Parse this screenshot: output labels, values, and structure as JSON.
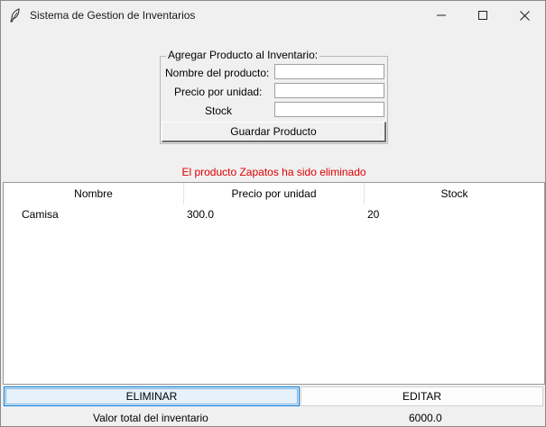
{
  "window": {
    "title": "Sistema de Gestion de Inventarios"
  },
  "form": {
    "legend": "Agregar Producto al Inventario:",
    "name_label": "Nombre del producto:",
    "price_label": "Precio por unidad:",
    "stock_label": "Stock",
    "name_value": "",
    "price_value": "",
    "stock_value": "",
    "save_label": "Guardar Producto"
  },
  "status": {
    "message": "El producto Zapatos ha sido eliminado",
    "color": "#e00000"
  },
  "table": {
    "columns": [
      "Nombre",
      "Precio por unidad",
      "Stock"
    ],
    "rows": [
      [
        "Camisa",
        "300.0",
        "20"
      ]
    ]
  },
  "actions": {
    "delete_label": "ELIMINAR",
    "edit_label": "EDITAR"
  },
  "summary": {
    "total_label": "Valor total del inventario",
    "total_value": "6000.0"
  },
  "icons": {
    "app": "feather-icon",
    "minimize": "minimize-icon",
    "maximize": "maximize-icon",
    "close": "close-icon"
  },
  "colors": {
    "accent": "#0078d7",
    "selected_button_bg": "#e5f1fb"
  }
}
